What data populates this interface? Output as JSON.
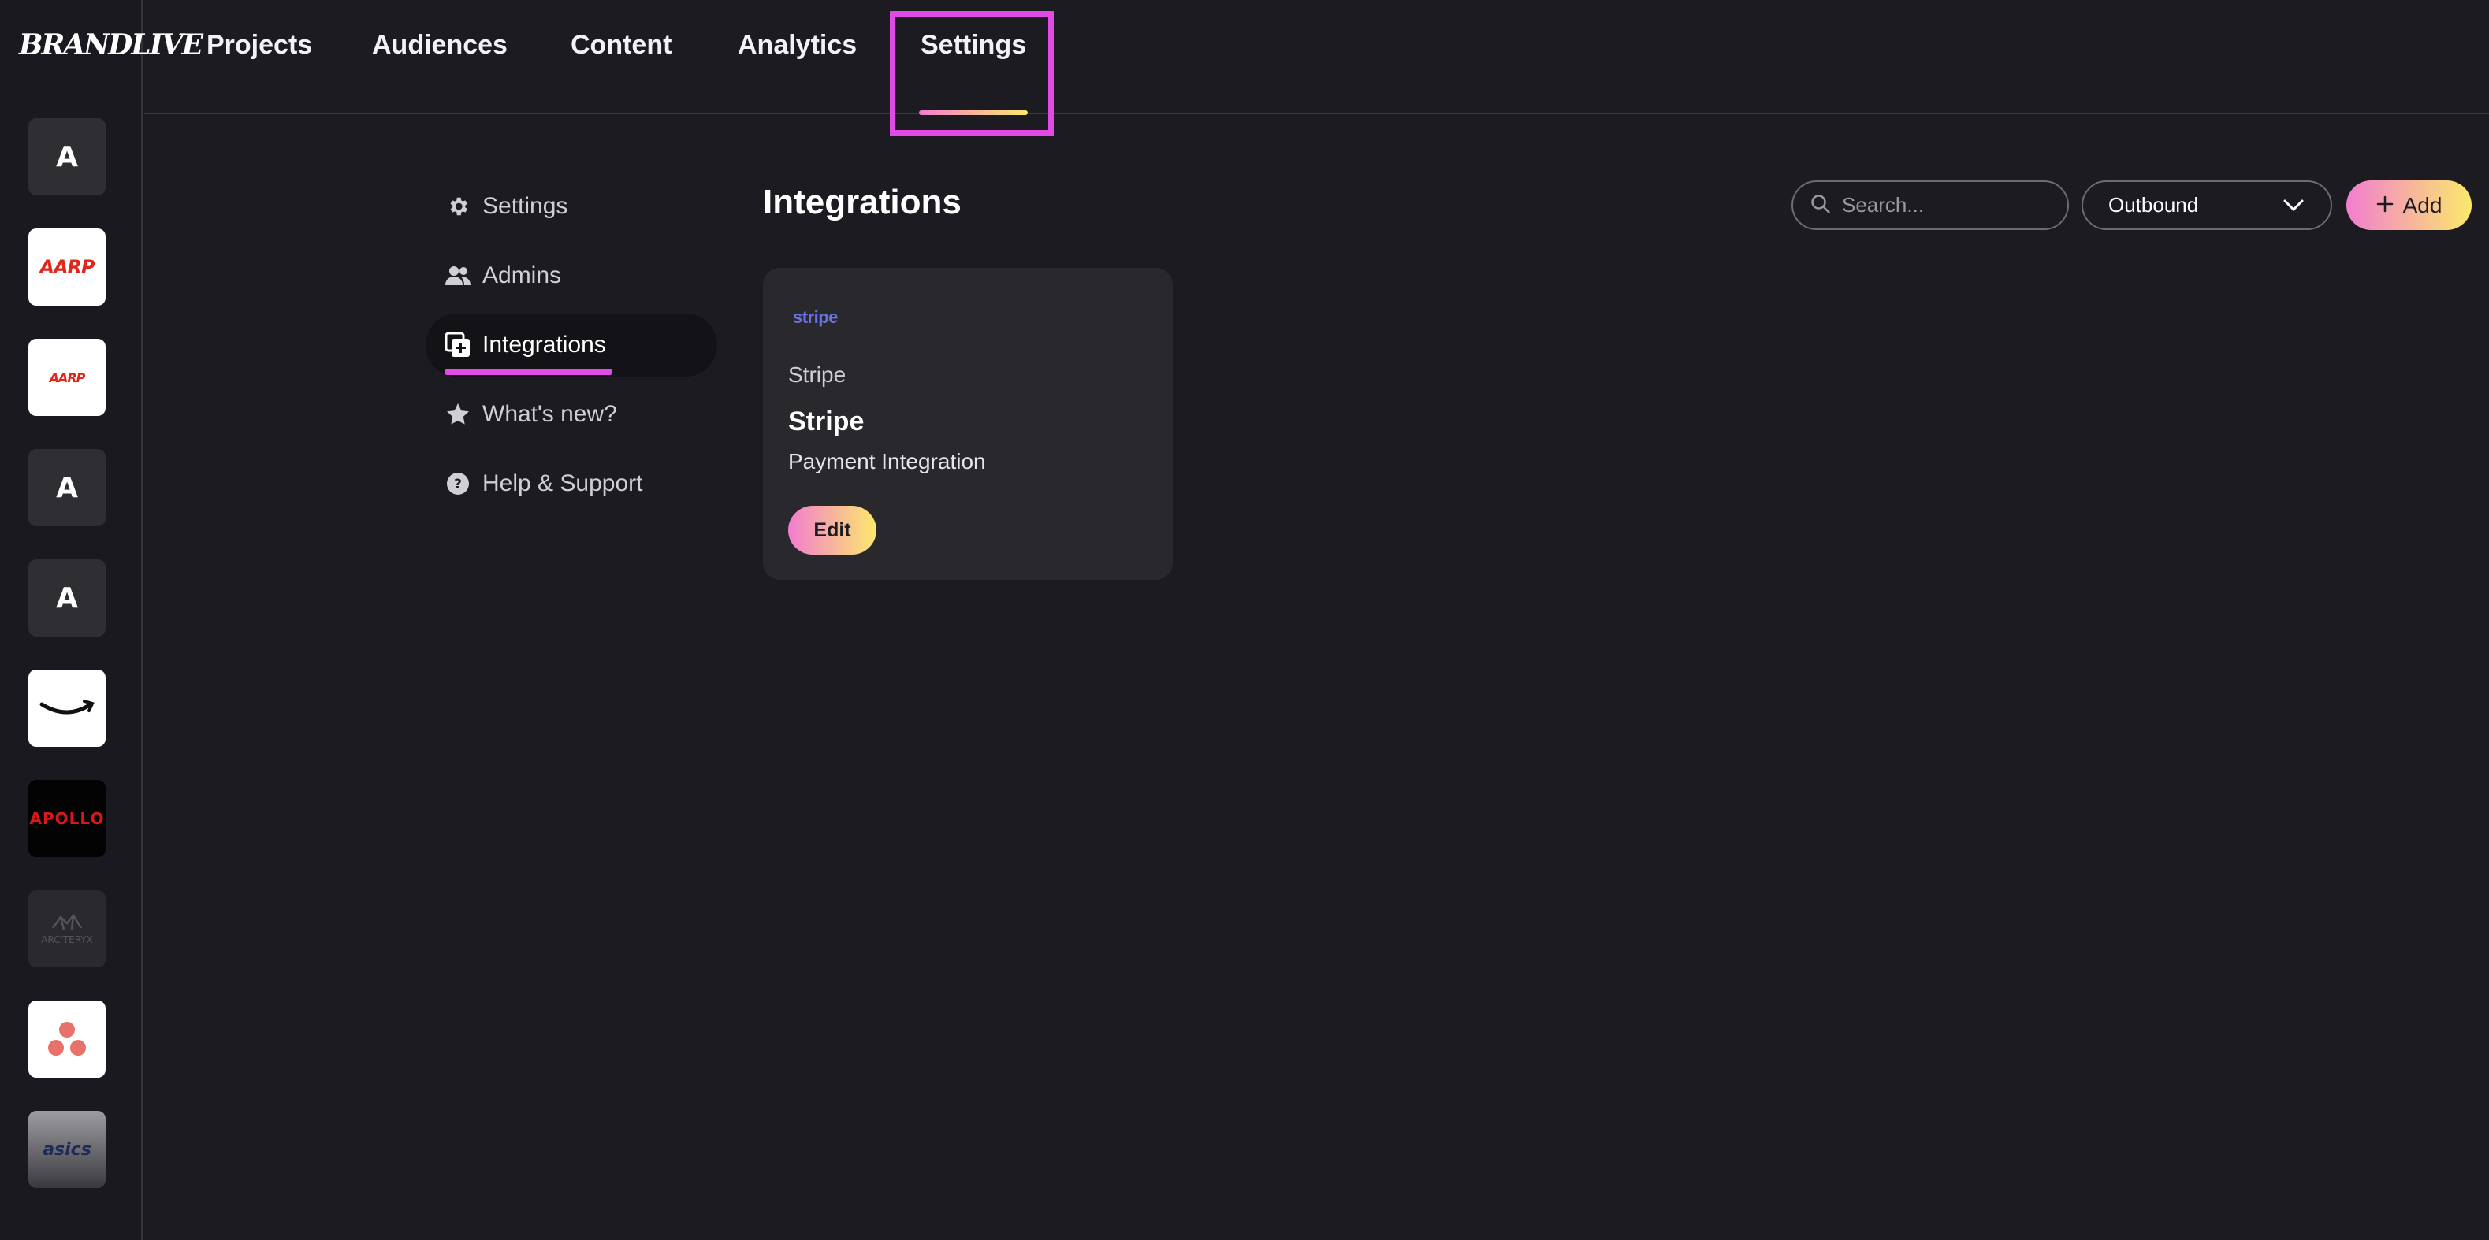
{
  "app": {
    "brand": "BRANDLIVE"
  },
  "workspaces": [
    {
      "label": "A",
      "style": "dark"
    },
    {
      "label": "AARP",
      "style": "white"
    },
    {
      "label": "AARP",
      "style": "white"
    },
    {
      "label": "A",
      "style": "dark"
    },
    {
      "label": "A",
      "style": "dark"
    },
    {
      "label": "",
      "style": "white",
      "icon": "amazon-smile-logo"
    },
    {
      "label": "APOLLO",
      "style": "black"
    },
    {
      "label": "ARC'TERYX",
      "style": "grey"
    },
    {
      "label": "",
      "style": "white",
      "icon": "asana-dots-logo"
    },
    {
      "label": "asics",
      "style": "gradient"
    }
  ],
  "top_nav": {
    "tabs": [
      "Projects",
      "Audiences",
      "Content",
      "Analytics",
      "Settings"
    ],
    "active": "Settings"
  },
  "settings_nav": {
    "items": [
      {
        "label": "Settings",
        "icon": "gear-icon"
      },
      {
        "label": "Admins",
        "icon": "users-icon"
      },
      {
        "label": "Integrations",
        "icon": "integrations-icon"
      },
      {
        "label": "What's new?",
        "icon": "star-icon"
      },
      {
        "label": "Help & Support",
        "icon": "help-icon"
      }
    ],
    "active": "Integrations"
  },
  "main": {
    "title": "Integrations",
    "search_placeholder": "Search...",
    "filter_value": "Outbound",
    "add_label": "Add"
  },
  "integration_card": {
    "logo_text": "stripe",
    "provider": "Stripe",
    "name": "Stripe",
    "description": "Payment Integration",
    "edit_label": "Edit"
  },
  "colors": {
    "background": "#1c1b21",
    "card": "#29282d",
    "accent_magenta": "#e04ae6",
    "gradient_start": "#f27dd0",
    "gradient_end": "#fbe96c",
    "stripe": "#6772e5"
  }
}
